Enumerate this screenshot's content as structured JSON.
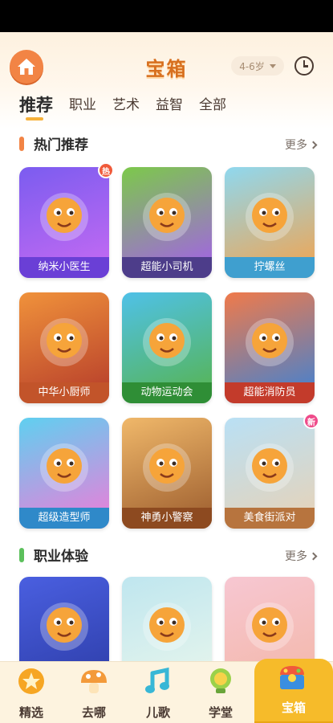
{
  "header": {
    "title": "宝箱",
    "age_range": "4-6岁"
  },
  "tabs": [
    {
      "label": "推荐",
      "active": true
    },
    {
      "label": "职业",
      "active": false
    },
    {
      "label": "艺术",
      "active": false
    },
    {
      "label": "益智",
      "active": false
    },
    {
      "label": "全部",
      "active": false
    }
  ],
  "sections": [
    {
      "title": "热门推荐",
      "more": "更多",
      "accent": "#f28445",
      "cards": [
        {
          "label": "纳米小医生",
          "badge": "热",
          "badge_color": "#f05a3a",
          "colors": [
            "#7b5cf0",
            "#c86bf2"
          ],
          "label_bg": "#6a3fd6"
        },
        {
          "label": "超能小司机",
          "colors": [
            "#7cc94a",
            "#a55bf0"
          ],
          "label_bg": "#4d3d8a"
        },
        {
          "label": "拧螺丝",
          "colors": [
            "#8fd8ef",
            "#f5a24a"
          ],
          "label_bg": "#3f9fcf"
        },
        {
          "label": "中华小厨师",
          "colors": [
            "#f0923b",
            "#b43a2a"
          ],
          "label_bg": "#c2542a"
        },
        {
          "label": "动物运动会",
          "colors": [
            "#4fc1e8",
            "#57b34a"
          ],
          "label_bg": "#2f8e36"
        },
        {
          "label": "超能消防员",
          "colors": [
            "#f07a4a",
            "#3a82d8"
          ],
          "label_bg": "#c33b2b"
        },
        {
          "label": "超级造型师",
          "colors": [
            "#5fd0f0",
            "#f27ad8"
          ],
          "label_bg": "#2f89c9"
        },
        {
          "label": "神勇小警察",
          "colors": [
            "#f0b86a",
            "#9a5b2d"
          ],
          "label_bg": "#8d4a20"
        },
        {
          "label": "美食街派对",
          "badge": "新",
          "badge_color": "#ef4b8a",
          "colors": [
            "#b9e0f5",
            "#e9d2b5"
          ],
          "label_bg": "#b7743e"
        }
      ]
    },
    {
      "title": "职业体验",
      "more": "更多",
      "accent": "#5cc05c",
      "cards": [
        {
          "label": "",
          "colors": [
            "#4a5fe0",
            "#2d3da8"
          ],
          "label_bg": ""
        },
        {
          "label": "",
          "colors": [
            "#bfe6ef",
            "#e8f6ec"
          ],
          "label_bg": ""
        },
        {
          "label": "",
          "colors": [
            "#f7c7d2",
            "#f3b7a8"
          ],
          "label_bg": ""
        }
      ]
    }
  ],
  "bottom_nav": [
    {
      "label": "精选",
      "icon": "star-badge-icon",
      "active": false,
      "color": "#f6a623"
    },
    {
      "label": "去哪",
      "icon": "mushroom-icon",
      "active": false,
      "color": "#f39a3a"
    },
    {
      "label": "儿歌",
      "icon": "music-note-icon",
      "active": false,
      "color": "#38b7d6"
    },
    {
      "label": "学堂",
      "icon": "lightbulb-icon",
      "active": false,
      "color": "#9bd14a"
    },
    {
      "label": "宝箱",
      "icon": "treasure-box-icon",
      "active": true,
      "color": "#f05a3a"
    }
  ]
}
